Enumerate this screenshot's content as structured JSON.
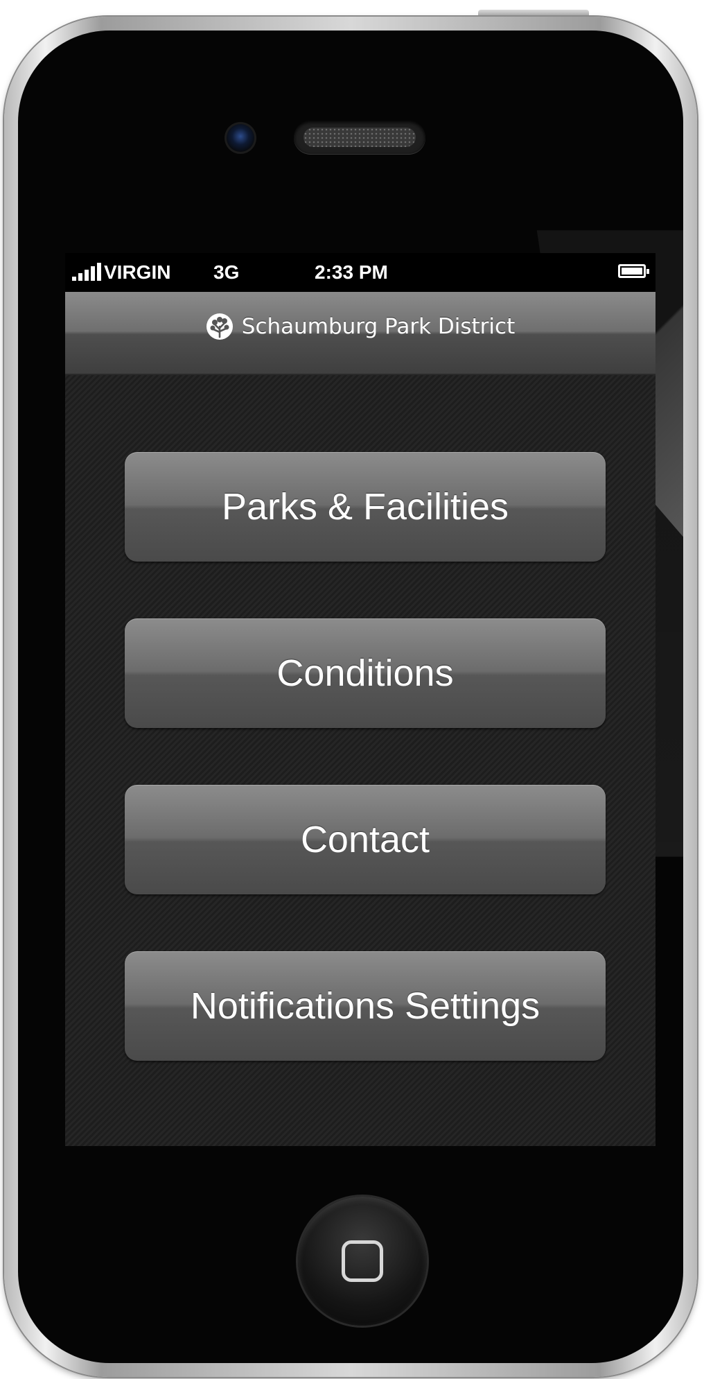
{
  "status_bar": {
    "carrier": "VIRGIN",
    "network": "3G",
    "time": "2:33 PM",
    "signal_icon": "signal-bars-icon",
    "battery_icon": "battery-full-icon"
  },
  "nav_bar": {
    "title": "Schaumburg Park District",
    "logo_icon": "tree-icon"
  },
  "menu": {
    "items": [
      {
        "label": "Parks & Facilities"
      },
      {
        "label": "Conditions"
      },
      {
        "label": "Contact"
      },
      {
        "label": "Notifications Settings"
      }
    ]
  },
  "device": {
    "home_button_icon": "home-square-icon"
  }
}
